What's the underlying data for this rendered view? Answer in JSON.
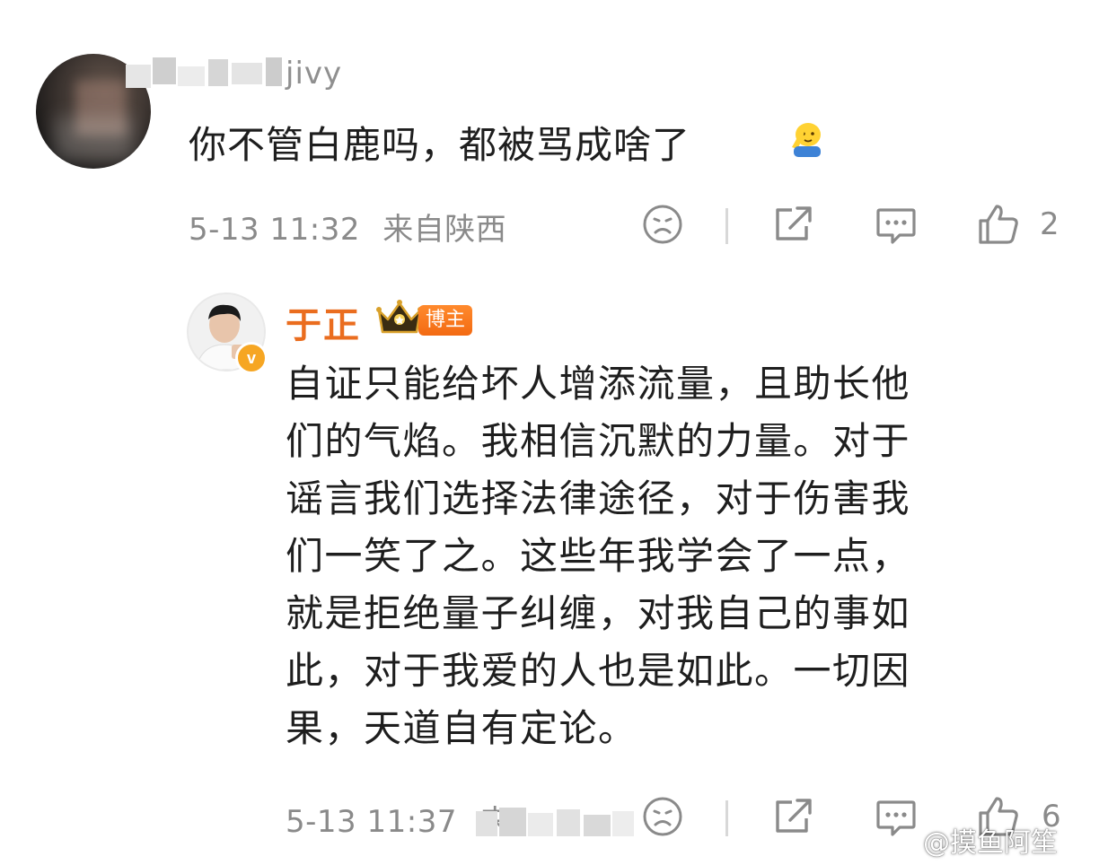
{
  "comment1": {
    "username_visible": "jivy",
    "text": "你不管白鹿吗，都被骂成啥了",
    "emoji": "facepalm-emoji",
    "time": "5-13 11:32",
    "location": "来自陕西",
    "like_count": "2"
  },
  "reply": {
    "author": "于正",
    "badge": "博主",
    "verified_icon": "v-verified-icon",
    "lines": [
      "自证只能给坏人增添流量，且助长他",
      "们的气焰。我相信沉默的力量。对于",
      "谣言我们选择法律途径，对于伤害我",
      "们一笑了之。这些年我学会了一点，",
      "就是拒绝量子纠缠，对我自己的事如",
      "此，对于我爱的人也是如此。一切因",
      "果，天道自有定论。"
    ],
    "time": "5-13 11:37",
    "location_partial": "来",
    "like_count": "6"
  },
  "watermark": "@摸鱼阿笙",
  "colors": {
    "author": "#ea6d1f",
    "meta": "#8a8a8a",
    "text": "#1e1e1e"
  }
}
